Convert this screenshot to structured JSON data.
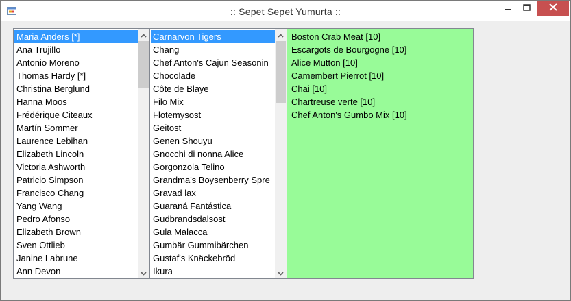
{
  "window": {
    "title": ":: Sepet Sepet Yumurta ::"
  },
  "icons": {
    "app": "form-app-icon",
    "minimize": "minimize-icon",
    "maximize": "maximize-icon",
    "close": "close-icon"
  },
  "colors": {
    "selection": "#3399ff",
    "basket_bg": "#98fb98",
    "close_btn": "#c75050"
  },
  "customers": {
    "selected_index": 0,
    "items": [
      "Maria Anders [*]",
      "Ana Trujillo",
      "Antonio Moreno",
      "Thomas Hardy [*]",
      "Christina Berglund",
      "Hanna Moos",
      "Frédérique Citeaux",
      "Martín Sommer",
      "Laurence Lebihan",
      "Elizabeth Lincoln",
      "Victoria Ashworth",
      "Patricio Simpson",
      "Francisco Chang",
      "Yang Wang",
      "Pedro Afonso",
      "Elizabeth Brown",
      "Sven Ottlieb",
      "Janine Labrune",
      "Ann Devon"
    ]
  },
  "products": {
    "selected_index": 0,
    "items": [
      "Carnarvon Tigers",
      "Chang",
      "Chef Anton's Cajun Seasonin",
      "Chocolade",
      "Côte de Blaye",
      "Filo Mix",
      "Flotemysost",
      "Geitost",
      "Genen Shouyu",
      "Gnocchi di nonna Alice",
      "Gorgonzola Telino",
      "Grandma's Boysenberry Spre",
      "Gravad lax",
      "Guaraná Fantástica",
      "Gudbrandsdalsost",
      "Gula Malacca",
      "Gumbär Gummibärchen",
      "Gustaf's Knäckebröd",
      "Ikura"
    ]
  },
  "basket": {
    "items": [
      "Boston Crab Meat [10]",
      "Escargots de Bourgogne [10]",
      "Alice Mutton [10]",
      "Camembert Pierrot [10]",
      "Chai [10]",
      "Chartreuse verte [10]",
      "Chef Anton's Gumbo Mix [10]"
    ]
  }
}
